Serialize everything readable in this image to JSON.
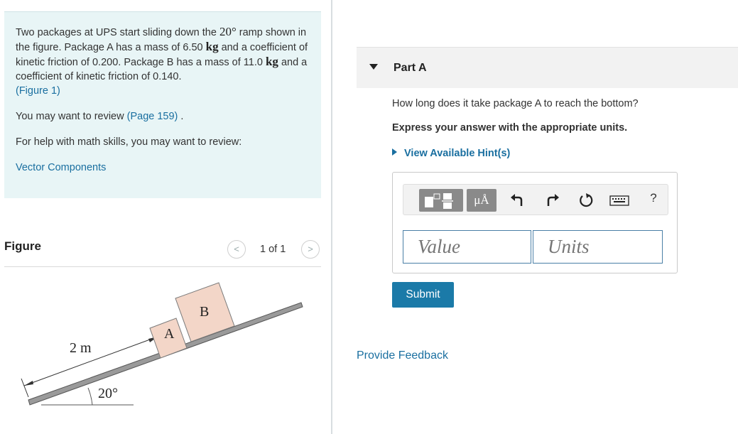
{
  "problem": {
    "seg1": "Two packages at UPS start sliding down the ",
    "angle_val": "20°",
    "seg2": " ramp shown in the figure. Package A has a mass of 6.50 ",
    "unit_kg_1": "kg",
    "seg3": " and a coefficient of kinetic friction of 0.200. Package B has a mass of 11.0 ",
    "unit_kg_2": "kg",
    "seg4": " and a coefficient of kinetic friction of 0.140.",
    "figure_link": "(Figure 1)",
    "review_prefix": "You may want to review ",
    "review_link": "(Page 159)",
    "review_suffix": " .",
    "math_help": "For help with math skills, you may want to review:",
    "vector_link": "Vector Components"
  },
  "figure": {
    "title": "Figure",
    "counter": "1 of 1",
    "prev": "<",
    "next": ">",
    "label_a": "A",
    "label_b": "B",
    "label_length": "2 m",
    "label_angle": "20°"
  },
  "part": {
    "title": "Part A",
    "question": "How long does it take package A to reach the bottom?",
    "instruction": "Express your answer with the appropriate units.",
    "hints": "View Available Hint(s)",
    "units_button": "μÅ",
    "help": "?",
    "value_placeholder": "Value",
    "units_placeholder": "Units",
    "submit": "Submit",
    "feedback": "Provide Feedback"
  },
  "colors": {
    "problem_bg": "#e8f5f6",
    "link": "#1a6fa0",
    "submit_bg": "#1b7aa8",
    "field_border": "#4a7fa6"
  }
}
